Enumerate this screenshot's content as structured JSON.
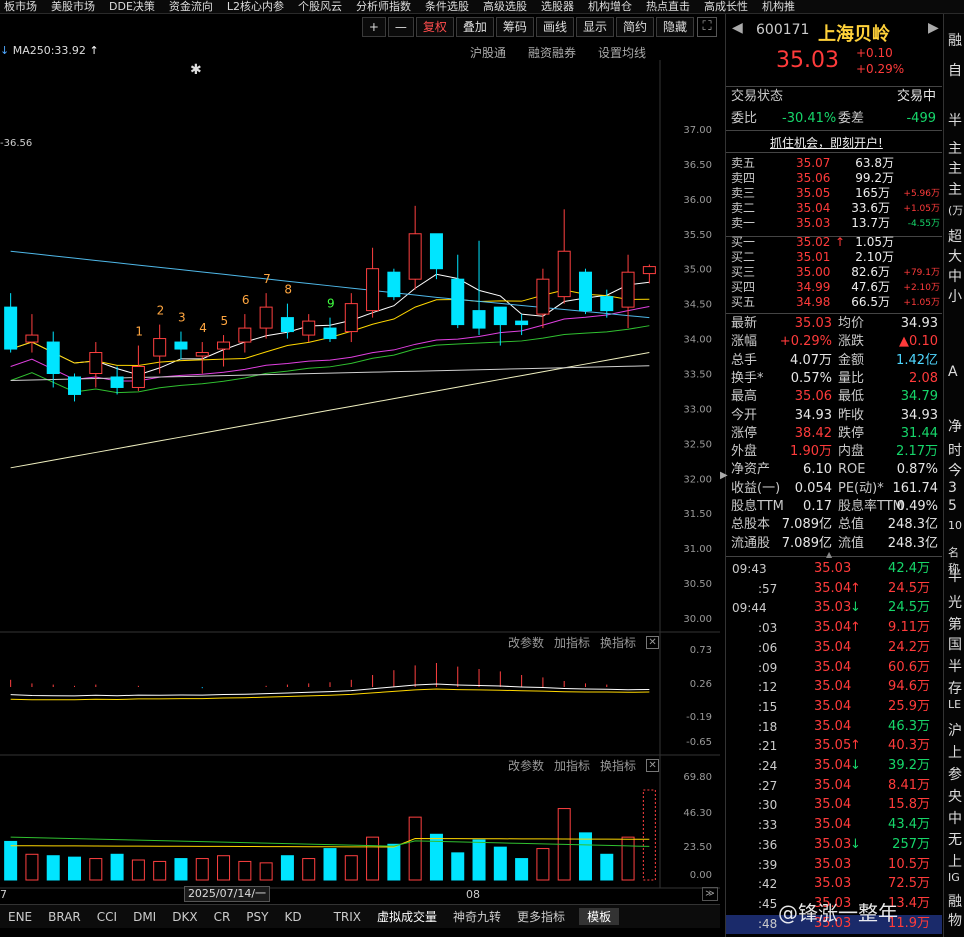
{
  "nav": [
    "板市场",
    "美股市场",
    "DDE决策",
    "资金流向",
    "L2核心内参",
    "个股风云",
    "分析师指数",
    "条件选股",
    "高级选股",
    "选股器",
    "机构增仓",
    "热点直击",
    "高成长性",
    "机构推"
  ],
  "toolbar": [
    "+",
    "—",
    "复权",
    "叠加",
    "筹码",
    "画线",
    "显示",
    "简约",
    "隐藏"
  ],
  "subbar": [
    "沪股通",
    "融资融券",
    "设置均线"
  ],
  "ma_label": "MA250:33.92",
  "left_cut_label": "-36.56",
  "price_axis": [
    "37.00",
    "36.50",
    "36.00",
    "35.50",
    "35.00",
    "34.50",
    "34.00",
    "33.50",
    "33.00",
    "32.50",
    "32.00",
    "31.50",
    "31.00",
    "30.50",
    "30.00"
  ],
  "signals": [
    {
      "n": "1",
      "c": "#ffa640"
    },
    {
      "n": "2",
      "c": "#ffa640"
    },
    {
      "n": "3",
      "c": "#ffa640"
    },
    {
      "n": "4",
      "c": "#ffa640"
    },
    {
      "n": "5",
      "c": "#ffa640"
    },
    {
      "n": "6",
      "c": "#ffa640"
    },
    {
      "n": "7",
      "c": "#ffa640"
    },
    {
      "n": "8",
      "c": "#ffa640"
    },
    {
      "n": "9",
      "c": "#40ff40"
    }
  ],
  "panel_ctl": [
    "改参数",
    "加指标",
    "换指标"
  ],
  "macd_axis": [
    "0.73",
    "0.26",
    "-0.19",
    "-0.65"
  ],
  "vol_axis": [
    "69.80",
    "46.30",
    "23.50",
    "0.00"
  ],
  "date_label": "2025/07/14/一",
  "x_left": "7",
  "x_mid": "08",
  "bottom_tabs": [
    "ENE",
    "BRAR",
    "CCI",
    "DMI",
    "DKX",
    "CR",
    "PSY",
    "KD",
    "",
    "TRIX",
    "虚拟成交量",
    "神奇九转",
    "更多指标",
    "模板"
  ],
  "quote": {
    "code": "600171",
    "name": "上海贝岭",
    "price": "35.03",
    "chg": "+0.10",
    "pct": "+0.29%",
    "state_label": "交易状态",
    "state": "交易中",
    "wb_label": "委比",
    "wb": "-30.41%",
    "wc_label": "委差",
    "wc": "-499",
    "banner": "抓住机会，即刻开户!"
  },
  "asks": [
    {
      "l": "卖五",
      "p": "35.07",
      "v": "63.8万",
      "d": ""
    },
    {
      "l": "卖四",
      "p": "35.06",
      "v": "99.2万",
      "d": ""
    },
    {
      "l": "卖三",
      "p": "35.05",
      "v": "165万",
      "d": "+5.96万"
    },
    {
      "l": "卖二",
      "p": "35.04",
      "v": "33.6万",
      "d": "+1.05万"
    },
    {
      "l": "卖一",
      "p": "35.03",
      "v": "13.7万",
      "d": "-4.55万"
    }
  ],
  "bids": [
    {
      "l": "买一",
      "p": "35.02",
      "v": "1.05万",
      "d": ""
    },
    {
      "l": "买二",
      "p": "35.01",
      "v": "2.10万",
      "d": ""
    },
    {
      "l": "买三",
      "p": "35.00",
      "v": "82.6万",
      "d": "+79.1万"
    },
    {
      "l": "买四",
      "p": "34.99",
      "v": "47.6万",
      "d": "+2.10万"
    },
    {
      "l": "买五",
      "p": "34.98",
      "v": "66.5万",
      "d": "+1.05万"
    }
  ],
  "stats": [
    [
      "最新",
      "35.03",
      "均价",
      "34.93"
    ],
    [
      "涨幅",
      "+0.29%",
      "涨跌",
      "▲0.10"
    ],
    [
      "总手",
      "4.07万",
      "金额",
      "1.42亿"
    ],
    [
      "换手*",
      "0.57%",
      "量比",
      "2.08"
    ],
    [
      "最高",
      "35.06",
      "最低",
      "34.79"
    ],
    [
      "今开",
      "34.93",
      "昨收",
      "34.93"
    ],
    [
      "涨停",
      "38.42",
      "跌停",
      "31.44"
    ],
    [
      "外盘",
      "1.90万",
      "内盘",
      "2.17万"
    ],
    [
      "净资产",
      "6.10",
      "ROE",
      "0.87%"
    ],
    [
      "收益(一)",
      "0.054",
      "PE(动)*",
      "161.74"
    ],
    [
      "股息TTM",
      "0.17",
      "股息率TTM",
      "0.49%"
    ],
    [
      "总股本",
      "7.089亿",
      "总值",
      "248.3亿"
    ],
    [
      "流通股",
      "7.089亿",
      "流值",
      "248.3亿"
    ]
  ],
  "ticks": [
    {
      "t": "09:43",
      "p": "35.03",
      "a": "",
      "v": "42.4万",
      "vc": "green"
    },
    {
      "t": ":57",
      "p": "35.04",
      "a": "up",
      "v": "24.5万",
      "vc": "red"
    },
    {
      "t": "09:44",
      "p": "35.03",
      "a": "down",
      "v": "24.5万",
      "vc": "green"
    },
    {
      "t": ":03",
      "p": "35.04",
      "a": "up",
      "v": "9.11万",
      "vc": "red"
    },
    {
      "t": ":06",
      "p": "35.04",
      "a": "",
      "v": "24.2万",
      "vc": "red"
    },
    {
      "t": ":09",
      "p": "35.04",
      "a": "",
      "v": "60.6万",
      "vc": "red"
    },
    {
      "t": ":12",
      "p": "35.04",
      "a": "",
      "v": "94.6万",
      "vc": "red"
    },
    {
      "t": ":15",
      "p": "35.04",
      "a": "",
      "v": "25.9万",
      "vc": "red"
    },
    {
      "t": ":18",
      "p": "35.04",
      "a": "",
      "v": "46.3万",
      "vc": "green"
    },
    {
      "t": ":21",
      "p": "35.05",
      "a": "up",
      "v": "40.3万",
      "vc": "red"
    },
    {
      "t": ":24",
      "p": "35.04",
      "a": "down",
      "v": "39.2万",
      "vc": "green"
    },
    {
      "t": ":27",
      "p": "35.04",
      "a": "",
      "v": "8.41万",
      "vc": "red"
    },
    {
      "t": ":30",
      "p": "35.04",
      "a": "",
      "v": "15.8万",
      "vc": "red"
    },
    {
      "t": ":33",
      "p": "35.04",
      "a": "",
      "v": "43.4万",
      "vc": "green"
    },
    {
      "t": ":36",
      "p": "35.03",
      "a": "down",
      "v": "257万",
      "vc": "green"
    },
    {
      "t": ":39",
      "p": "35.03",
      "a": "",
      "v": "10.5万",
      "vc": "red"
    },
    {
      "t": ":42",
      "p": "35.03",
      "a": "",
      "v": "72.5万",
      "vc": "red"
    },
    {
      "t": ":45",
      "p": "35.03",
      "a": "",
      "v": "13.4万",
      "vc": "red"
    },
    {
      "t": ":48",
      "p": "35.03",
      "a": "",
      "v": "11.9万",
      "vc": "red"
    }
  ],
  "far": [
    "融",
    "自",
    "半",
    "主",
    "主",
    "主",
    "(万",
    "超",
    "大",
    "中",
    "小",
    "A",
    "净",
    "时",
    "今",
    "3",
    "5",
    "10",
    "名称",
    "半",
    "光",
    "第",
    "国",
    "半",
    "存",
    "LE",
    "沪",
    "上",
    "参",
    "央",
    "中",
    "无",
    "上",
    "IG",
    "融",
    "物"
  ],
  "watermark": "@锋涨一整年",
  "chart_data": {
    "type": "candlestick",
    "ylim": [
      29.9,
      37.2
    ],
    "candles": [
      {
        "o": 34.45,
        "c": 33.85,
        "h": 34.65,
        "l": 33.8
      },
      {
        "o": 33.95,
        "c": 34.05,
        "h": 34.35,
        "l": 33.8
      },
      {
        "o": 33.95,
        "c": 33.5,
        "h": 34.1,
        "l": 33.3
      },
      {
        "o": 33.45,
        "c": 33.2,
        "h": 33.5,
        "l": 33.1
      },
      {
        "o": 33.5,
        "c": 33.8,
        "h": 33.95,
        "l": 33.3
      },
      {
        "o": 33.45,
        "c": 33.3,
        "h": 33.6,
        "l": 33.2
      },
      {
        "o": 33.3,
        "c": 33.6,
        "h": 33.9,
        "l": 33.25
      },
      {
        "o": 33.75,
        "c": 34.0,
        "h": 34.2,
        "l": 33.5
      },
      {
        "o": 33.95,
        "c": 33.85,
        "h": 34.1,
        "l": 33.7
      },
      {
        "o": 33.75,
        "c": 33.8,
        "h": 33.95,
        "l": 33.5
      },
      {
        "o": 33.85,
        "c": 33.95,
        "h": 34.05,
        "l": 33.6
      },
      {
        "o": 33.95,
        "c": 34.15,
        "h": 34.35,
        "l": 33.8
      },
      {
        "o": 34.15,
        "c": 34.45,
        "h": 34.65,
        "l": 34.0
      },
      {
        "o": 34.3,
        "c": 34.1,
        "h": 34.5,
        "l": 34.0
      },
      {
        "o": 34.05,
        "c": 34.25,
        "h": 34.35,
        "l": 33.95
      },
      {
        "o": 34.15,
        "c": 34.0,
        "h": 34.3,
        "l": 33.95
      },
      {
        "o": 34.1,
        "c": 34.5,
        "h": 34.65,
        "l": 33.95
      },
      {
        "o": 34.4,
        "c": 35.0,
        "h": 35.3,
        "l": 34.3
      },
      {
        "o": 34.95,
        "c": 34.6,
        "h": 35.0,
        "l": 34.55
      },
      {
        "o": 34.85,
        "c": 35.5,
        "h": 35.9,
        "l": 34.7
      },
      {
        "o": 35.5,
        "c": 35.0,
        "h": 35.5,
        "l": 34.85
      },
      {
        "o": 34.85,
        "c": 34.2,
        "h": 35.2,
        "l": 34.15
      },
      {
        "o": 34.4,
        "c": 34.15,
        "h": 35.4,
        "l": 34.05
      },
      {
        "o": 34.45,
        "c": 34.2,
        "h": 34.45,
        "l": 33.9
      },
      {
        "o": 34.25,
        "c": 34.2,
        "h": 34.35,
        "l": 34.05
      },
      {
        "o": 34.35,
        "c": 34.85,
        "h": 35.0,
        "l": 34.15
      },
      {
        "o": 34.6,
        "c": 35.25,
        "h": 35.85,
        "l": 34.5
      },
      {
        "o": 34.95,
        "c": 34.4,
        "h": 35.0,
        "l": 34.35
      },
      {
        "o": 34.6,
        "c": 34.4,
        "h": 34.7,
        "l": 34.3
      },
      {
        "o": 34.45,
        "c": 34.95,
        "h": 35.2,
        "l": 34.15
      },
      {
        "o": 34.93,
        "c": 35.03,
        "h": 35.06,
        "l": 34.79
      }
    ],
    "volume": [
      27,
      18,
      17,
      16,
      15,
      18,
      14,
      13,
      15,
      15,
      17,
      13,
      12,
      17,
      15,
      22,
      17,
      30,
      25,
      44,
      32,
      19,
      28,
      23,
      15,
      22,
      50,
      33,
      18,
      30,
      63
    ],
    "macd": [
      0.06,
      0.03,
      0.02,
      0.01,
      0.02,
      0.0,
      0.01,
      0.0,
      0.0,
      -0.01,
      0.0,
      0.0,
      0.01,
      0.02,
      0.03,
      0.04,
      0.06,
      0.1,
      0.14,
      0.18,
      0.2,
      0.17,
      0.15,
      0.13,
      0.1,
      0.08,
      0.05,
      0.03,
      0.02,
      0.0,
      0.0
    ]
  }
}
